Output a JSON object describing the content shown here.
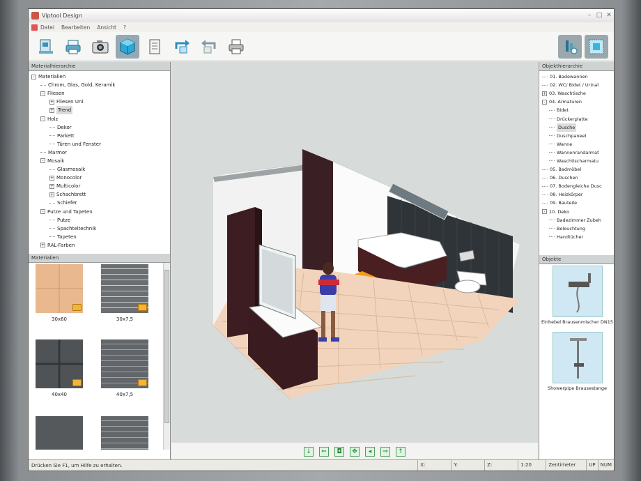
{
  "window": {
    "title": "Viptool Design"
  },
  "menu": [
    "Datei",
    "Bearbeiten",
    "Ansicht",
    "?"
  ],
  "toolbar": {
    "icons": [
      "preview-icon",
      "print-preview-icon",
      "camera-icon",
      "3d-view-icon",
      "document-icon",
      "rotate-icon",
      "refresh-icon",
      "printer-icon"
    ],
    "active": "3d-view-icon"
  },
  "material_tree": {
    "header": "Materialhierarchie",
    "items": [
      {
        "label": "Materialien",
        "level": 0,
        "expander": "-"
      },
      {
        "label": "Chrom, Glas, Gold, Keramik",
        "level": 1,
        "expander": ""
      },
      {
        "label": "Fliesen",
        "level": 1,
        "expander": "-"
      },
      {
        "label": "Fliesen Uni",
        "level": 2,
        "expander": "+"
      },
      {
        "label": "Trend",
        "level": 2,
        "expander": "+",
        "selected": true
      },
      {
        "label": "Holz",
        "level": 1,
        "expander": "-"
      },
      {
        "label": "Dekor",
        "level": 2,
        "expander": ""
      },
      {
        "label": "Parkett",
        "level": 2,
        "expander": ""
      },
      {
        "label": "Türen und Fenster",
        "level": 2,
        "expander": ""
      },
      {
        "label": "Marmor",
        "level": 1,
        "expander": ""
      },
      {
        "label": "Mosaik",
        "level": 1,
        "expander": "-"
      },
      {
        "label": "Glasmosaik",
        "level": 2,
        "expander": ""
      },
      {
        "label": "Monocolor",
        "level": 2,
        "expander": "+"
      },
      {
        "label": "Multicolor",
        "level": 2,
        "expander": "+"
      },
      {
        "label": "Schachbrett",
        "level": 2,
        "expander": "+"
      },
      {
        "label": "Schiefer",
        "level": 2,
        "expander": ""
      },
      {
        "label": "Putze und Tapeten",
        "level": 1,
        "expander": "-"
      },
      {
        "label": "Putze",
        "level": 2,
        "expander": ""
      },
      {
        "label": "Spachteltechnik",
        "level": 2,
        "expander": ""
      },
      {
        "label": "Tapeten",
        "level": 2,
        "expander": ""
      },
      {
        "label": "RAL-Farben",
        "level": 1,
        "expander": "+"
      }
    ]
  },
  "materials": {
    "header": "Materialien",
    "items": [
      {
        "label": "30x60",
        "color": "#e9b88e"
      },
      {
        "label": "30x7,5",
        "color": "#6c6f72"
      },
      {
        "label": "40x40",
        "color": "#505356"
      },
      {
        "label": "40x7,5",
        "color": "#62666a"
      },
      {
        "label": "",
        "color": "#56595c"
      },
      {
        "label": "",
        "color": "#63676a"
      }
    ]
  },
  "object_tree": {
    "header": "Objekthierarchie",
    "items": [
      {
        "label": "01. Badewannen",
        "level": 0,
        "expander": ""
      },
      {
        "label": "02. WC/ Bidet / Urinal",
        "level": 0,
        "expander": ""
      },
      {
        "label": "03. Waschtische",
        "level": 0,
        "expander": "+"
      },
      {
        "label": "04. Armaturen",
        "level": 0,
        "expander": "-"
      },
      {
        "label": "Bidet",
        "level": 1,
        "expander": ""
      },
      {
        "label": "Drückerplatte",
        "level": 1,
        "expander": ""
      },
      {
        "label": "Dusche",
        "level": 1,
        "expander": "",
        "selected": true
      },
      {
        "label": "Duschpaneel",
        "level": 1,
        "expander": ""
      },
      {
        "label": "Wanne",
        "level": 1,
        "expander": ""
      },
      {
        "label": "Wannenrandarmat",
        "level": 1,
        "expander": ""
      },
      {
        "label": "Waschtischarmatu",
        "level": 1,
        "expander": ""
      },
      {
        "label": "05. Badmöbel",
        "level": 0,
        "expander": ""
      },
      {
        "label": "06. Duschen",
        "level": 0,
        "expander": ""
      },
      {
        "label": "07. Bodengleiche Dusc",
        "level": 0,
        "expander": ""
      },
      {
        "label": "08. Heizkörper",
        "level": 0,
        "expander": ""
      },
      {
        "label": "09. Bauteile",
        "level": 0,
        "expander": ""
      },
      {
        "label": "10. Deko",
        "level": 0,
        "expander": "-"
      },
      {
        "label": "Badezimmer Zubeh",
        "level": 1,
        "expander": ""
      },
      {
        "label": "Beleuchtung",
        "level": 1,
        "expander": ""
      },
      {
        "label": "Handtücher",
        "level": 1,
        "expander": ""
      }
    ]
  },
  "objects": {
    "header": "Objekte",
    "items": [
      {
        "label": "Einhebel Brausenmischer DN15"
      },
      {
        "label": "Showerpipe Brausestange"
      }
    ]
  },
  "nav_buttons": [
    "↓",
    "⇐",
    "◘",
    "✥",
    "◂",
    "⇒",
    "↑"
  ],
  "status": {
    "message": "Drücken Sie F1, um Hilfe zu erhalten.",
    "x_label": "X:",
    "y_label": "Y:",
    "z_label": "Z:",
    "scale": "1:20",
    "unit": "Zentimeter",
    "up": "UP",
    "num": "NUM"
  }
}
